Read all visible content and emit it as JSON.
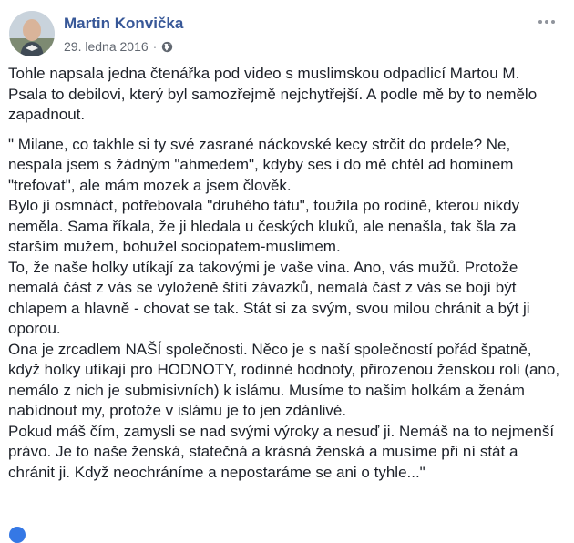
{
  "post": {
    "author": "Martin Konvička",
    "date": "29. ledna 2016",
    "separator": "·",
    "privacy_icon": "globe-icon",
    "more_icon": "more-options-icon",
    "paragraphs": [
      "Tohle napsala jedna čtenářka pod video s muslimskou odpadlicí Martou M. Psala to debilovi, který byl samozřejmě nejchytřejší. A podle mě by to nemělo zapadnout.",
      "\" Milane, co takhle si ty své zasrané náckovské kecy strčit do prdele? Ne, nespala jsem s žádným \"ahmedem\", kdyby ses i do mě chtěl ad hominem \"trefovat\", ale mám mozek a jsem člověk.\nBylo jí osmnáct, potřebovala \"druhého tátu\", toužila po rodině, kterou nikdy neměla. Sama říkala, že ji hledala u českých kluků, ale nenašla, tak šla za starším mužem, bohužel sociopatem-muslimem.\nTo, že naše holky utíkají za takovými je vaše vina. Ano, vás mužů. Protože nemalá část z vás se vyloženě štítí závazků, nemalá část z vás se bojí být chlapem a hlavně - chovat se tak. Stát si za svým, svou milou chránit a být ji oporou.\nOna je zrcadlem NAŠÍ společnosti. Něco je s naší společností pořád špatně, když holky utíkají pro HODNOTY, rodinné hodnoty, přirozenou ženskou roli (ano, nemálo z nich je submisivních) k islámu. Musíme to našim holkám a ženám nabídnout my, protože v islámu je to jen zdánlivé.\nPokud máš čím, zamysli se nad svými výroky a nesuď ji. Nemáš na to nejmenší právo. Je to naše ženská, statečná a krásná ženská a musíme při ní stát a chránit ji. Když neochráníme a nepostaráme se ani o tyhle...\""
    ]
  },
  "colors": {
    "author_link": "#385898",
    "meta_text": "#616770",
    "body_text": "#1d2129"
  }
}
